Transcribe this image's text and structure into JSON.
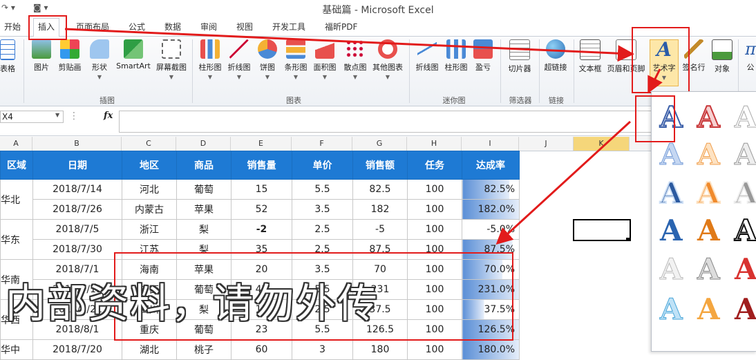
{
  "window": {
    "title": "基础篇 - Microsoft Excel"
  },
  "tabs": [
    "开始",
    "插入",
    "页面布局",
    "公式",
    "数据",
    "审阅",
    "视图",
    "开发工具",
    "福昕PDF"
  ],
  "ribbon": {
    "buttons": [
      "表格",
      "图片",
      "剪贴画",
      "形状",
      "SmartArt",
      "屏幕截图",
      "柱形图",
      "折线图",
      "饼图",
      "条形图",
      "面积图",
      "散点图",
      "其他图表",
      "折线图",
      "柱形图",
      "盈亏",
      "切片器",
      "超链接",
      "文本框",
      "页眉和页脚",
      "艺术字",
      "签名行",
      "对象",
      "公"
    ],
    "groups": [
      "插图",
      "图表",
      "迷你图",
      "筛选器",
      "链接"
    ]
  },
  "formula_bar": {
    "name_box": "X4",
    "fx": "fx",
    "value": ""
  },
  "columns": [
    "A",
    "B",
    "C",
    "D",
    "E",
    "F",
    "G",
    "H",
    "I",
    "J",
    "K"
  ],
  "sheet": {
    "headers": [
      "区域",
      "日期",
      "地区",
      "商品",
      "销售量",
      "单价",
      "销售额",
      "任务",
      "达成率"
    ],
    "rows": [
      {
        "region": "华北",
        "date": "2018/7/14",
        "area": "河北",
        "product": "葡萄",
        "qty": "15",
        "price": "5.5",
        "sales": "82.5",
        "task": "100",
        "rate": "82.5%",
        "fill": 0.825
      },
      {
        "region": "",
        "date": "2018/7/26",
        "area": "内蒙古",
        "product": "苹果",
        "qty": "52",
        "price": "3.5",
        "sales": "182",
        "task": "100",
        "rate": "182.0%",
        "fill": 1.0
      },
      {
        "region": "华东",
        "date": "2018/7/5",
        "area": "浙江",
        "product": "梨",
        "qty": "-2",
        "price": "2.5",
        "sales": "-5",
        "task": "100",
        "rate": "-5.0%",
        "fill": 0
      },
      {
        "region": "",
        "date": "2018/7/30",
        "area": "江苏",
        "product": "梨",
        "qty": "35",
        "price": "2.5",
        "sales": "87.5",
        "task": "100",
        "rate": "87.5%",
        "fill": 0.875
      },
      {
        "region": "华南",
        "date": "2018/7/1",
        "area": "海南",
        "product": "苹果",
        "qty": "20",
        "price": "3.5",
        "sales": "70",
        "task": "100",
        "rate": "70.0%",
        "fill": 0.7
      },
      {
        "region": "",
        "date": "2018/7/11",
        "area": "广西",
        "product": "葡萄",
        "qty": "42",
        "price": "5.5",
        "sales": "231",
        "task": "100",
        "rate": "231.0%",
        "fill": 1.0
      },
      {
        "region": "华西",
        "date": "2018/7/21",
        "area": "四川",
        "product": "梨",
        "qty": "15",
        "price": "2.5",
        "sales": "37.5",
        "task": "100",
        "rate": "37.5%",
        "fill": 0.375
      },
      {
        "region": "",
        "date": "2018/8/1",
        "area": "重庆",
        "product": "葡萄",
        "qty": "23",
        "price": "5.5",
        "sales": "126.5",
        "task": "100",
        "rate": "126.5%",
        "fill": 1.0
      },
      {
        "region": "华中",
        "date": "2018/7/20",
        "area": "湖北",
        "product": "桃子",
        "qty": "60",
        "price": "3",
        "sales": "180",
        "task": "100",
        "rate": "180.0%",
        "fill": 1.0
      }
    ]
  },
  "watermark": "内部资料，请勿外传",
  "colors": {
    "header_blue": "#1e7ad4",
    "highlight_red": "#e21b1b",
    "databar_blue": "#5b8fd6"
  }
}
